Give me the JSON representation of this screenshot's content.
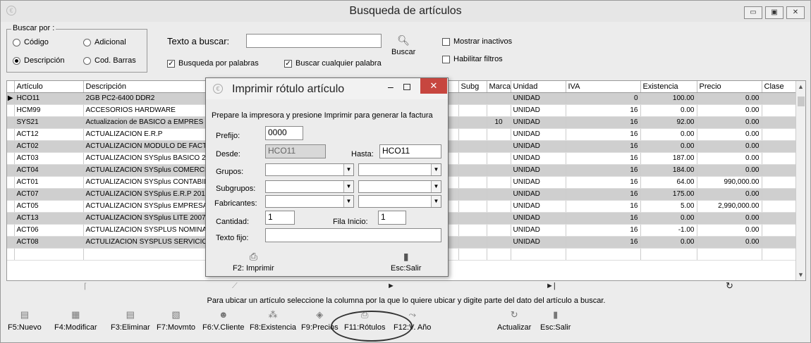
{
  "window": {
    "title": "Busqueda de artículos"
  },
  "search_by": {
    "legend": "Buscar por :",
    "codigo": "Código",
    "adicional": "Adicional",
    "descripcion": "Descripción",
    "cod_barras": "Cod. Barras",
    "selected": "Descripción"
  },
  "search": {
    "label": "Texto a buscar:",
    "value": "",
    "button_label": "Buscar",
    "by_words": "Busqueda por palabras",
    "any_word": "Buscar cualquier palabra",
    "show_inactive": "Mostrar inactivos",
    "enable_filters": "Habilitar filtros"
  },
  "table": {
    "columns": [
      "Artículo",
      "Descripción",
      "",
      "o",
      "Subg",
      "Marca",
      "Unidad",
      "IVA",
      "Existencia",
      "Precio",
      "Clase"
    ],
    "rows": [
      {
        "articulo": "HCO11",
        "descripcion": "2GB PC2-6400 DDR2",
        "marca": "",
        "unidad": "UNIDAD",
        "iva": "0",
        "existencia": "100.00",
        "precio": "0.00"
      },
      {
        "articulo": "HCM99",
        "descripcion": "ACCESORIOS HARDWARE",
        "marca": "",
        "unidad": "UNIDAD",
        "iva": "16",
        "existencia": "0.00",
        "precio": "0.00"
      },
      {
        "articulo": "SYS21",
        "descripcion": "Actualizacion de BASICO  a  EMPRES",
        "marca": "10",
        "unidad": "UNIDAD",
        "iva": "16",
        "existencia": "92.00",
        "precio": "0.00"
      },
      {
        "articulo": "ACT12",
        "descripcion": "ACTUALIZACION E.R.P",
        "marca": "",
        "unidad": "UNIDAD",
        "iva": "16",
        "existencia": "0.00",
        "precio": "0.00"
      },
      {
        "articulo": "ACT02",
        "descripcion": "ACTUALIZACION MODULO DE FACT",
        "marca": "",
        "unidad": "UNIDAD",
        "iva": "16",
        "existencia": "0.00",
        "precio": "0.00"
      },
      {
        "articulo": "ACT03",
        "descripcion": "ACTUALIZACION SYSplus BASICO 2(",
        "marca": "",
        "unidad": "UNIDAD",
        "iva": "16",
        "existencia": "187.00",
        "precio": "0.00"
      },
      {
        "articulo": "ACT04",
        "descripcion": "ACTUALIZACION SYSplus COMERCI",
        "marca": "",
        "unidad": "UNIDAD",
        "iva": "16",
        "existencia": "184.00",
        "precio": "0.00"
      },
      {
        "articulo": "ACT01",
        "descripcion": "ACTUALIZACION SYSplus CONTABIL",
        "marca": "",
        "unidad": "UNIDAD",
        "iva": "16",
        "existencia": "64.00",
        "precio": "990,000.00"
      },
      {
        "articulo": "ACT07",
        "descripcion": "ACTUALIZACION SYSplus E.R.P 201(",
        "marca": "",
        "unidad": "UNIDAD",
        "iva": "16",
        "existencia": "175.00",
        "precio": "0.00"
      },
      {
        "articulo": "ACT05",
        "descripcion": "ACTUALIZACION SYSplus EMPRESA",
        "marca": "",
        "unidad": "UNIDAD",
        "iva": "16",
        "existencia": "5.00",
        "precio": "2,990,000.00"
      },
      {
        "articulo": "ACT13",
        "descripcion": "ACTUALIZACION SYSplus LITE 2007",
        "marca": "",
        "unidad": "UNIDAD",
        "iva": "16",
        "existencia": "0.00",
        "precio": "0.00"
      },
      {
        "articulo": "ACT06",
        "descripcion": "ACTUALIZACION SYSPLUS NOMINA",
        "marca": "",
        "unidad": "UNIDAD",
        "iva": "16",
        "existencia": "-1.00",
        "precio": "0.00"
      },
      {
        "articulo": "ACT08",
        "descripcion": "ACTULIZACION SYSPLUS SERVICIO",
        "marca": "",
        "unidad": "UNIDAD",
        "iva": "16",
        "existencia": "0.00",
        "precio": "0.00"
      }
    ]
  },
  "hint": "Para ubicar un artículo seleccione la columna por la que lo quiere ubicar y digite parte del dato del artículo a buscar.",
  "toolbar": [
    {
      "label": "F5:Nuevo",
      "icon": "new-icon"
    },
    {
      "label": "F4:Modificar",
      "icon": "edit-icon"
    },
    {
      "label": "F3:Eliminar",
      "icon": "delete-icon"
    },
    {
      "label": "F7:Movmto",
      "icon": "movement-icon"
    },
    {
      "label": "F6:V.Cliente",
      "icon": "client-icon"
    },
    {
      "label": "F8:Existencia",
      "icon": "stock-icon"
    },
    {
      "label": "F9:Precios",
      "icon": "price-tag-icon"
    },
    {
      "label": "F11:Rótulos",
      "icon": "print-icon"
    },
    {
      "label": "F12:V. Año",
      "icon": "chart-icon"
    },
    {
      "label": "Actualizar",
      "icon": "refresh-icon"
    },
    {
      "label": "Esc:Salir",
      "icon": "exit-icon"
    }
  ],
  "dialog": {
    "title": "Imprimir rótulo artículo",
    "instructions": "Prepare la impresora y presione Imprimir para generar la factura",
    "prefijo_label": "Prefijo:",
    "prefijo_value": "0000",
    "desde_label": "Desde:",
    "desde_value": "HCO11",
    "hasta_label": "Hasta:",
    "hasta_value": "HCO11",
    "grupos_label": "Grupos:",
    "subgrupos_label": "Subgrupos:",
    "fabricantes_label": "Fabricantes:",
    "cantidad_label": "Cantidad:",
    "cantidad_value": "1",
    "fila_label": "Fila Inicio:",
    "fila_value": "1",
    "texto_label": "Texto fijo:",
    "texto_value": "",
    "print_label": "F2: Imprimir",
    "exit_label": "Esc:Salir"
  }
}
